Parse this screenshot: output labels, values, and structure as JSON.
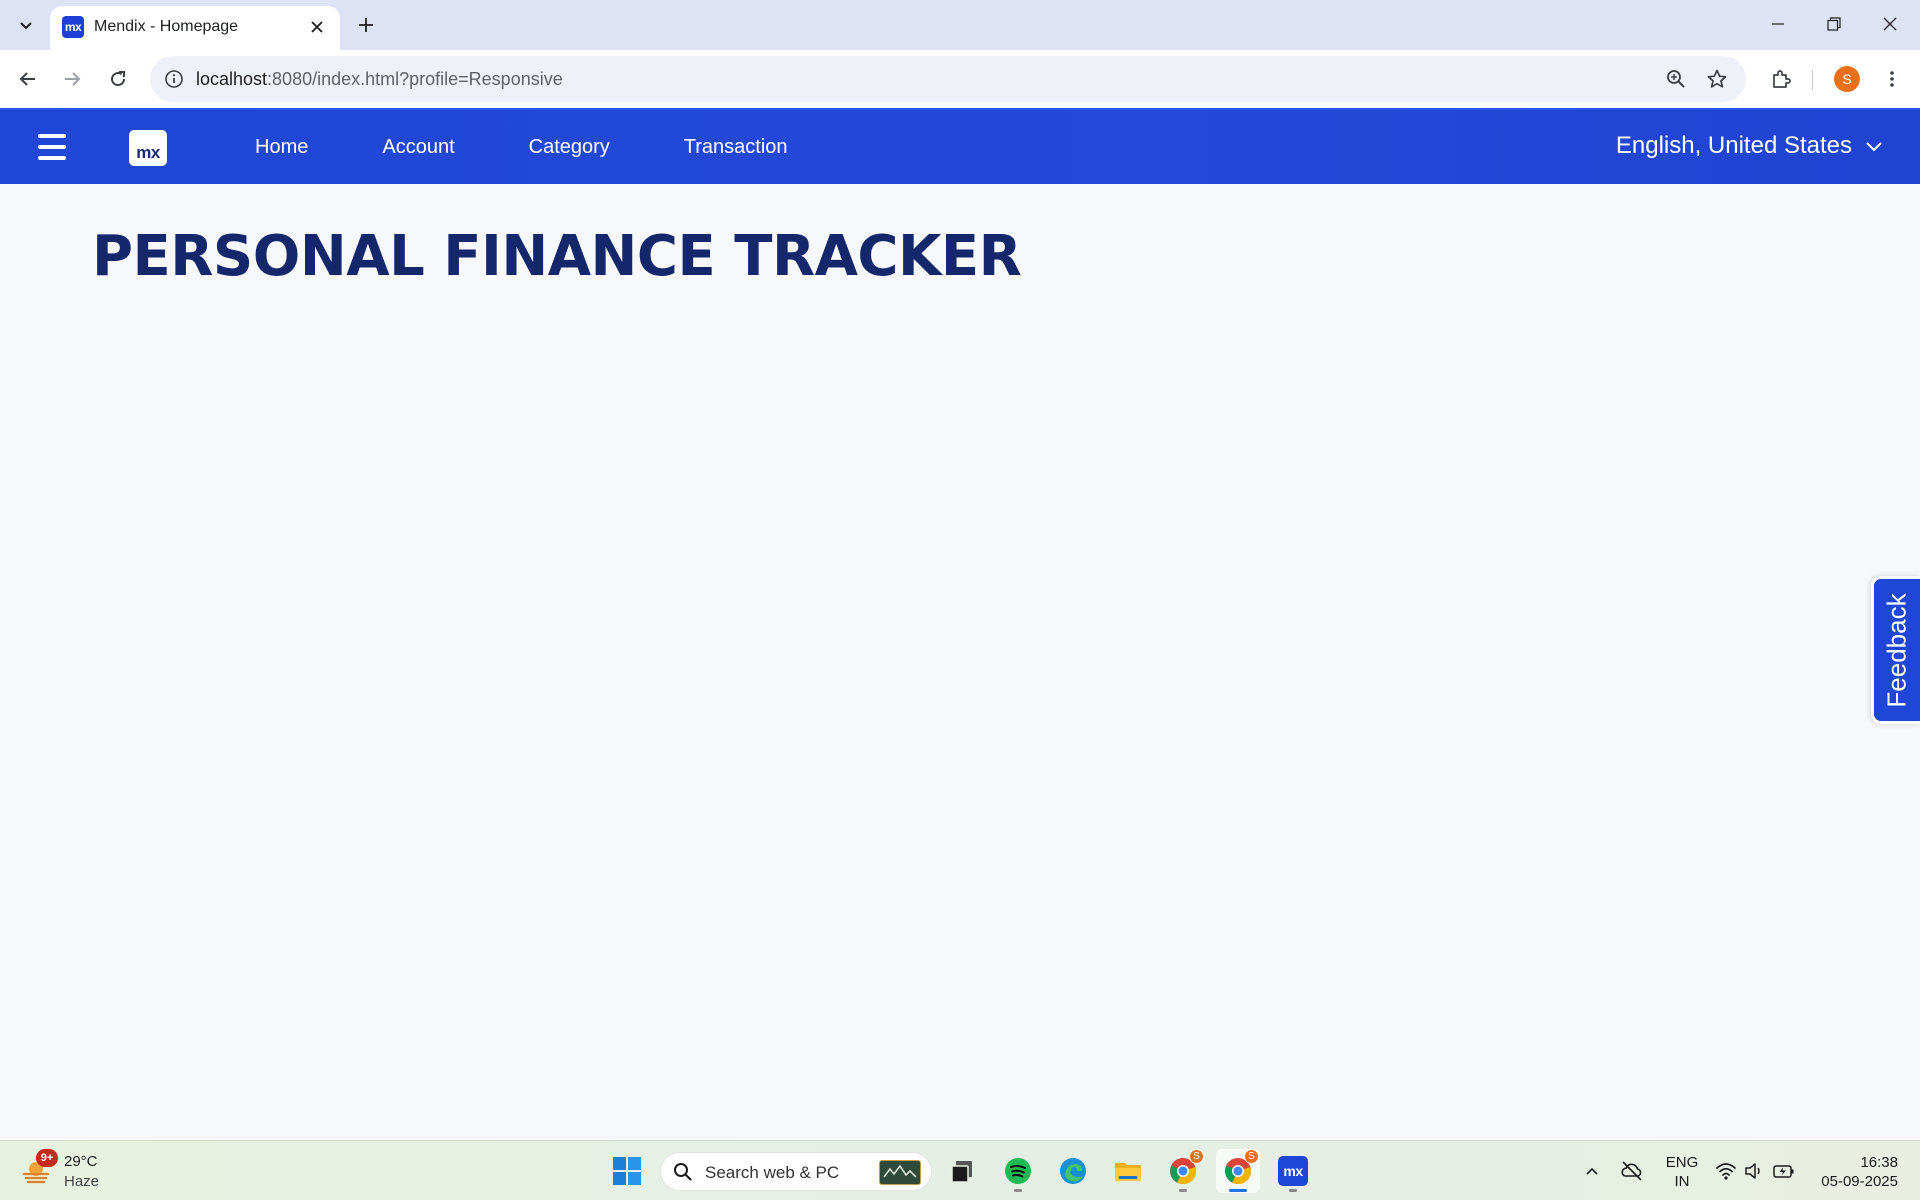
{
  "browser": {
    "tab_title": "Mendix - Homepage",
    "favicon_text": "mx",
    "url_host": "localhost",
    "url_rest": ":8080/index.html?profile=Responsive",
    "profile_initial": "S"
  },
  "app": {
    "logo_text": "mx",
    "nav_items": [
      "Home",
      "Account",
      "Category",
      "Transaction"
    ],
    "language": "English, United States",
    "page_title": "PERSONAL FINANCE TRACKER",
    "feedback_label": "Feedback",
    "brand_color": "#1f46d6",
    "title_color": "#14276b"
  },
  "taskbar": {
    "weather_badge": "9+",
    "weather_temp": "29°C",
    "weather_condition": "Haze",
    "search_placeholder": "Search web & PC",
    "chrome_badge": "S",
    "lang_line1": "ENG",
    "lang_line2": "IN",
    "time": "16:38",
    "date": "05-09-2025"
  }
}
